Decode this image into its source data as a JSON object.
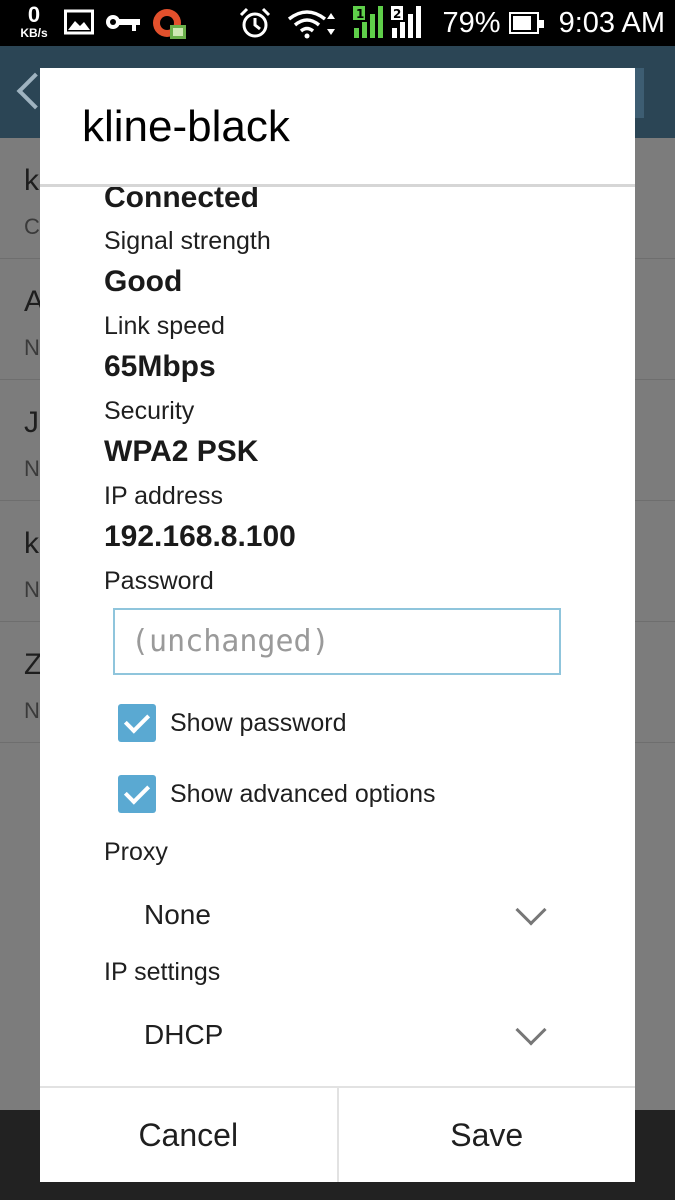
{
  "status_bar": {
    "net_speed_value": "0",
    "net_speed_unit": "KB/s",
    "battery_percent": "79%",
    "time": "9:03 AM"
  },
  "background_list": {
    "items": [
      {
        "title": "k",
        "subtitle": "C"
      },
      {
        "title": "A",
        "subtitle": "N"
      },
      {
        "title": "J",
        "subtitle": "N"
      },
      {
        "title": "k",
        "subtitle": "N"
      },
      {
        "title": "Z",
        "subtitle": "N"
      }
    ]
  },
  "dialog": {
    "title": "kline-black",
    "status_value": "Connected",
    "signal_label": "Signal strength",
    "signal_value": "Good",
    "link_speed_label": "Link speed",
    "link_speed_value": "65Mbps",
    "security_label": "Security",
    "security_value": "WPA2 PSK",
    "ip_label": "IP address",
    "ip_value": "192.168.8.100",
    "password_label": "Password",
    "password_placeholder": "(unchanged)",
    "show_password_label": "Show password",
    "show_password_checked": true,
    "show_advanced_label": "Show advanced options",
    "show_advanced_checked": true,
    "proxy_label": "Proxy",
    "proxy_value": "None",
    "ip_settings_label": "IP settings",
    "ip_settings_value": "DHCP",
    "cancel_label": "Cancel",
    "save_label": "Save"
  },
  "colors": {
    "accent": "#5aa9d2",
    "header": "#2b4555"
  }
}
